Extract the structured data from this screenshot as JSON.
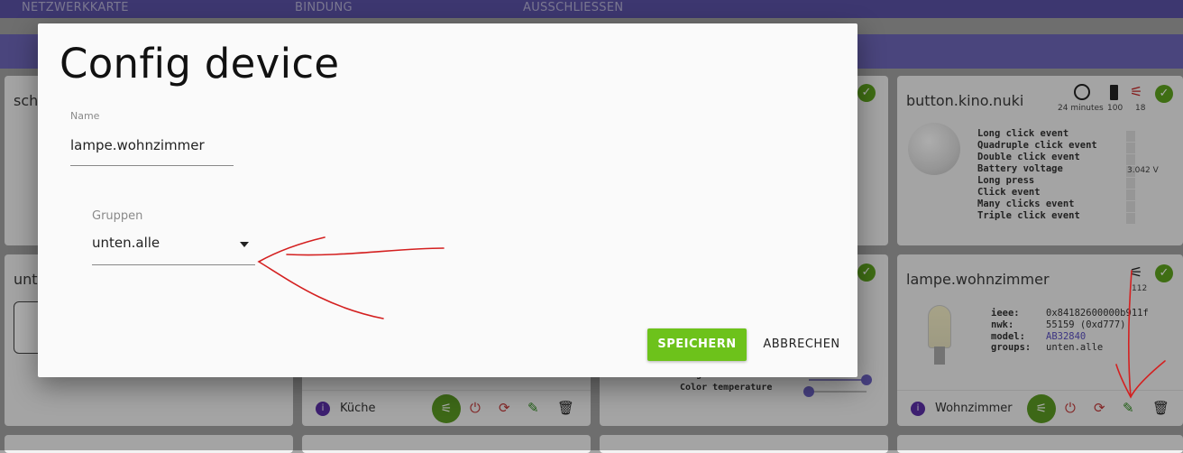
{
  "tabs": [
    "NETZWERKKARTE",
    "BINDUNG",
    "AUSSCHLIESSEN"
  ],
  "cards": {
    "c1": {
      "title": "sch"
    },
    "c4": {
      "title": "unt"
    },
    "button": {
      "title": "button.kino.nuki",
      "stat_time": "24 minutes",
      "stat_battery": "100",
      "stat_link": "18",
      "events": [
        "Long click event",
        "Quadruple click event",
        "Double click event",
        "Battery voltage",
        "Long press",
        "Click event",
        "Many clicks event",
        "Triple click event"
      ],
      "voltage": "3.042 V"
    },
    "lampe": {
      "title": "lampe.wohnzimmer",
      "stat_link": "112",
      "ieee_label": "ieee:",
      "ieee": "0x84182600000b911f",
      "nwk_label": "nwk:",
      "nwk": "55159 (0xd777)",
      "model_label": "model:",
      "model": "AB32840",
      "groups_label": "groups:",
      "groups": "unten.alle",
      "room": "Wohnzimmer"
    },
    "kueche": {
      "room": "Küche"
    },
    "light": {
      "brightness": "brightness",
      "color_temp": "Color temperature"
    }
  },
  "dialog": {
    "title": "Config device",
    "name_label": "Name",
    "name_value": "lampe.wohnzimmer",
    "groups_label": "Gruppen",
    "groups_value": "unten.alle",
    "save": "SPEICHERN",
    "cancel": "ABBRECHEN"
  },
  "colors": {
    "accent": "#6dc21b",
    "topbar": "#5b52a6",
    "annotation": "#d42020"
  }
}
